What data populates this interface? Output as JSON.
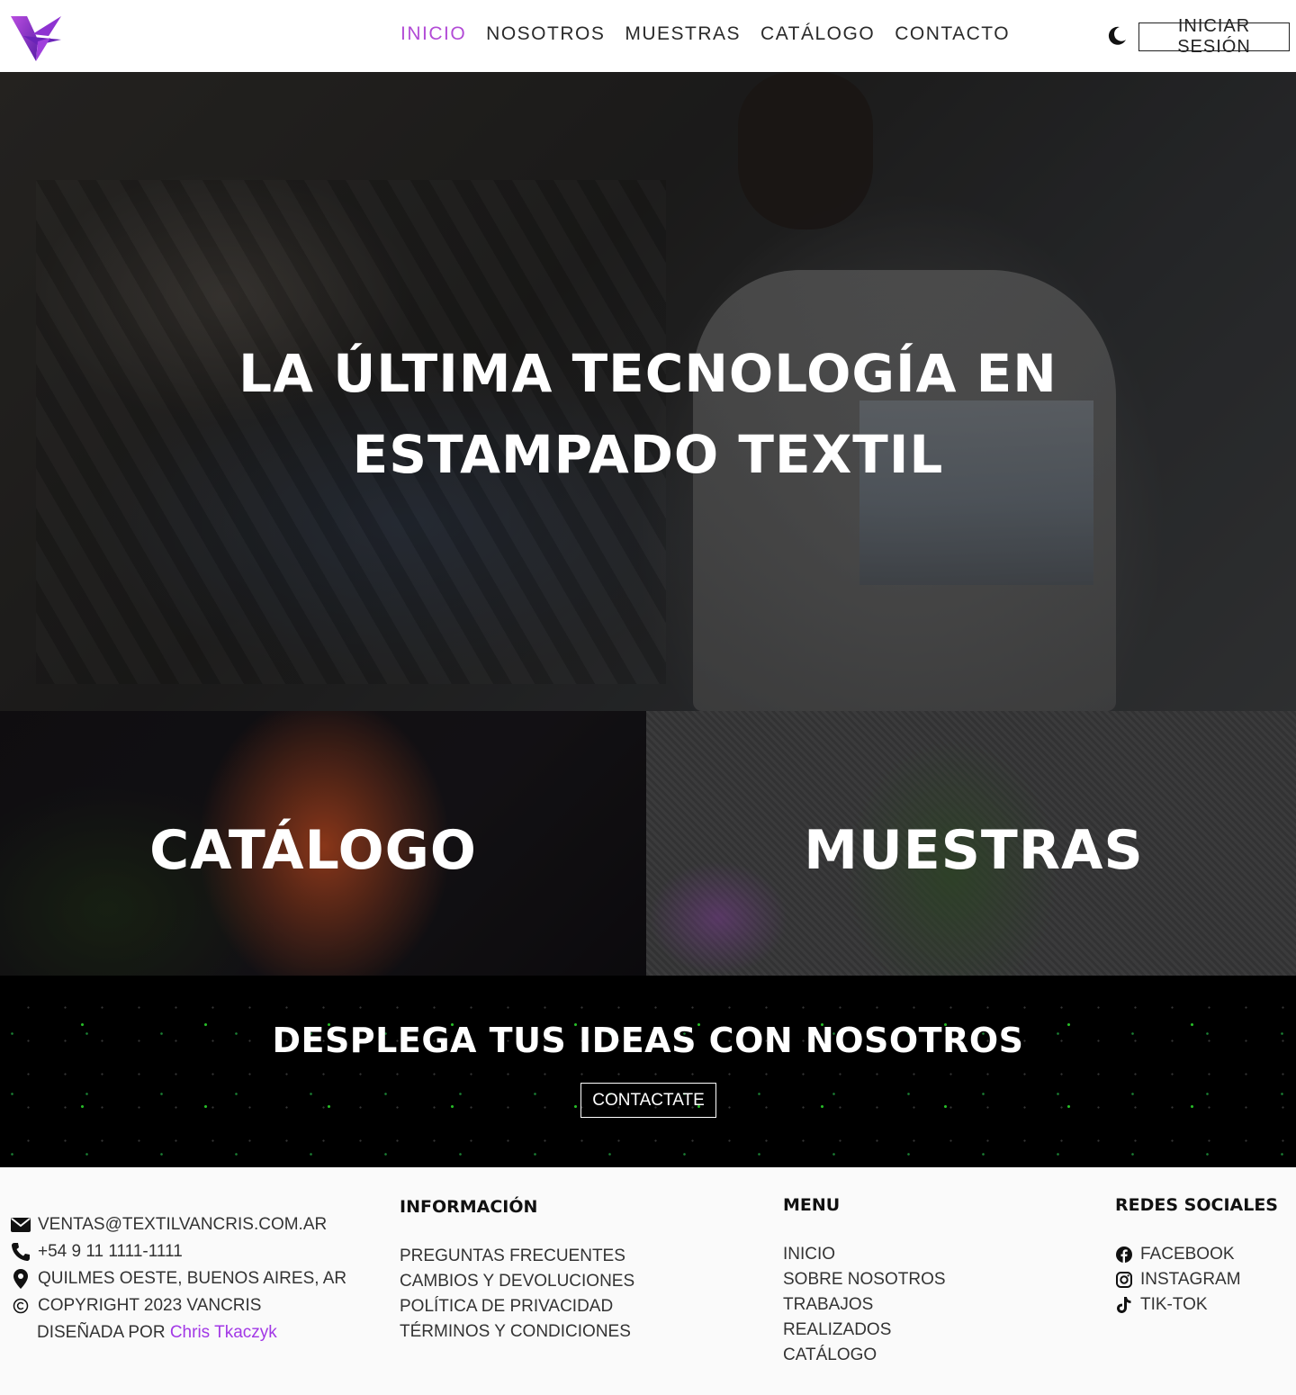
{
  "nav": {
    "links": [
      "INICIO",
      "NOSOTROS",
      "MUESTRAS",
      "CATÁLOGO",
      "CONTACTO"
    ],
    "active": "INICIO",
    "login_label": "INICIAR SESIÓN",
    "accent_color": "#b24bd6"
  },
  "hero": {
    "title": "LA ÚLTIMA TECNOLOGÍA EN ESTAMPADO TEXTIL"
  },
  "tiles": {
    "catalog_label": "CATÁLOGO",
    "samples_label": "MUESTRAS"
  },
  "cta": {
    "title": "DESPLEGA TUS IDEAS CON NOSOTROS",
    "button_label": "CONTACTATE"
  },
  "footer": {
    "contact": {
      "email": "VENTAS@TEXTILVANCRIS.COM.AR",
      "phone": "+54 9 11 1111-1111",
      "location": "QUILMES OESTE, BUENOS AIRES, AR",
      "copyright": "COPYRIGHT 2023 VANCRIS",
      "designed_prefix": "DISEÑADA POR",
      "designer": "Chris Tkaczyk"
    },
    "info": {
      "heading": "INFORMACIÓN",
      "links": [
        "PREGUNTAS FRECUENTES",
        "CAMBIOS Y DEVOLUCIONES",
        "POLÍTICA DE PRIVACIDAD",
        "TÉRMINOS Y CONDICIONES"
      ]
    },
    "menu": {
      "heading": "MENU",
      "links": [
        "INICIO",
        "SOBRE NOSOTROS",
        "TRABAJOS",
        "REALIZADOS",
        "CATÁLOGO"
      ]
    },
    "social": {
      "heading": "REDES SOCIALES",
      "links": [
        "FACEBOOK",
        "INSTAGRAM",
        "TIK-TOK"
      ]
    }
  },
  "icons": [
    "logo-v-icon",
    "moon-icon",
    "envelope-icon",
    "phone-icon",
    "location-pin-icon",
    "copyright-icon",
    "facebook-icon",
    "instagram-icon",
    "tiktok-icon"
  ],
  "colors": {
    "accent": "#b24bd6",
    "designer_link": "#a238e6",
    "cta_dots": "#2bd12b"
  }
}
